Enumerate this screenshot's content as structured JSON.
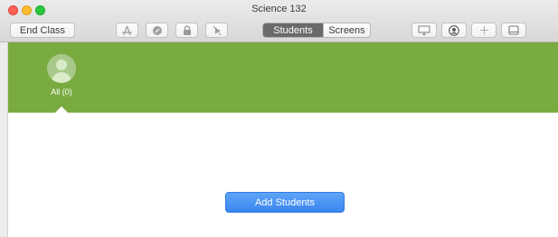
{
  "window": {
    "title": "Science 132"
  },
  "toolbar": {
    "end_class_label": "End Class",
    "icons_left": [
      "apps-icon",
      "navigate-icon",
      "lock-icon",
      "mute-icon"
    ],
    "segmented": {
      "active": "Students",
      "inactive": "Screens"
    },
    "icons_right": [
      "airplay-icon",
      "profile-icon",
      "add-icon",
      "sidebar-icon"
    ]
  },
  "groups": {
    "items": [
      {
        "label": "All (0)"
      }
    ],
    "accent_color": "#7aab41"
  },
  "main": {
    "add_students_label": "Add Students"
  },
  "colors": {
    "primary_button": "#3a86f0"
  }
}
